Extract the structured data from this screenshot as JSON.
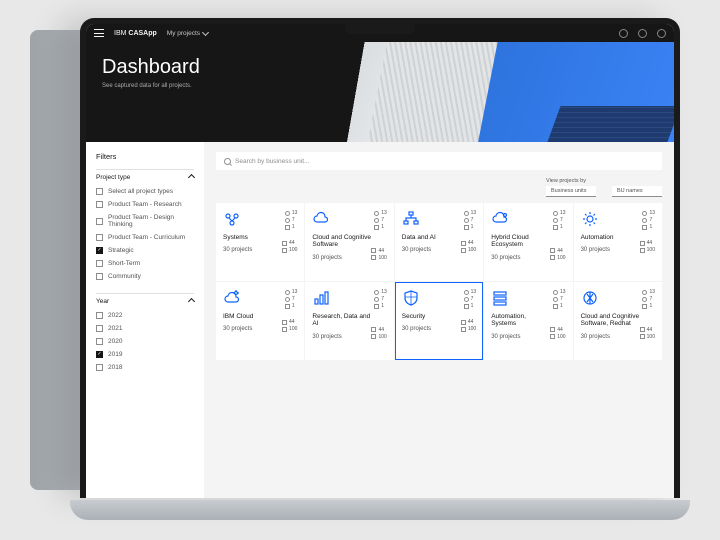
{
  "topnav": {
    "brand_prefix": "IBM",
    "brand_name": "CASApp",
    "link": "My projects"
  },
  "hero": {
    "title": "Dashboard",
    "subtitle": "See captured data for all projects."
  },
  "sidebar": {
    "title": "Filters",
    "group_project_type": {
      "label": "Project type",
      "items": [
        {
          "label": "Select all project types",
          "checked": false
        },
        {
          "label": "Product Team - Research",
          "checked": false
        },
        {
          "label": "Product Team - Design Thinking",
          "checked": false
        },
        {
          "label": "Product Team - Curriculum",
          "checked": false
        },
        {
          "label": "Strategic",
          "checked": true
        },
        {
          "label": "Short-Term",
          "checked": false
        },
        {
          "label": "Community",
          "checked": false
        }
      ]
    },
    "group_year": {
      "label": "Year",
      "items": [
        {
          "label": "2022",
          "checked": false
        },
        {
          "label": "2021",
          "checked": false
        },
        {
          "label": "2020",
          "checked": false
        },
        {
          "label": "2019",
          "checked": true
        },
        {
          "label": "2018",
          "checked": false
        }
      ]
    }
  },
  "main": {
    "search_placeholder": "Search by business unit...",
    "view_by_label": "View projects by",
    "view_by_value": "Business units",
    "sort_value": "BU names",
    "cards": [
      {
        "name": "Systems",
        "projects": "30 projects",
        "a": "13",
        "b": "7",
        "c": "1",
        "d": "44",
        "e": "100",
        "icon": "nodes"
      },
      {
        "name": "Cloud and Cognitive Software",
        "projects": "30 projects",
        "a": "13",
        "b": "7",
        "c": "1",
        "d": "44",
        "e": "100",
        "icon": "cloud"
      },
      {
        "name": "Data and AI",
        "projects": "30 projects",
        "a": "13",
        "b": "7",
        "c": "1",
        "d": "44",
        "e": "100",
        "icon": "tree"
      },
      {
        "name": "Hybrid Cloud Ecosystem",
        "projects": "30 projects",
        "a": "13",
        "b": "7",
        "c": "1",
        "d": "44",
        "e": "100",
        "icon": "cloud2"
      },
      {
        "name": "Automation",
        "projects": "30 projects",
        "a": "13",
        "b": "7",
        "c": "1",
        "d": "44",
        "e": "100",
        "icon": "gear"
      },
      {
        "name": "IBM Cloud",
        "projects": "30 projects",
        "a": "13",
        "b": "7",
        "c": "1",
        "d": "44",
        "e": "100",
        "icon": "sun"
      },
      {
        "name": "Research, Data and AI",
        "projects": "30 projects",
        "a": "13",
        "b": "7",
        "c": "1",
        "d": "44",
        "e": "100",
        "icon": "bars"
      },
      {
        "name": "Security",
        "projects": "30 projects",
        "a": "13",
        "b": "7",
        "c": "1",
        "d": "44",
        "e": "100",
        "icon": "shield",
        "selected": true
      },
      {
        "name": "Automation, Systems",
        "projects": "30 projects",
        "a": "13",
        "b": "7",
        "c": "1",
        "d": "44",
        "e": "100",
        "icon": "stack"
      },
      {
        "name": "Cloud and Cognitive Software, Redhat",
        "projects": "30 projects",
        "a": "13",
        "b": "7",
        "c": "1",
        "d": "44",
        "e": "100",
        "icon": "circle"
      }
    ]
  }
}
